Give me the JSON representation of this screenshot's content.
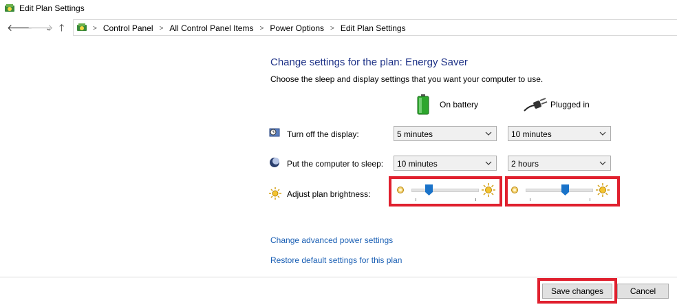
{
  "window": {
    "title": "Edit Plan Settings"
  },
  "nav": {
    "back": "back",
    "forward": "forward",
    "recent": "recent",
    "up": "up"
  },
  "breadcrumb": [
    "Control Panel",
    "All Control Panel Items",
    "Power Options",
    "Edit Plan Settings"
  ],
  "main": {
    "heading": "Change settings for the plan: Energy Saver",
    "subheading": "Choose the sleep and display settings that you want your computer to use.",
    "columns": {
      "battery": "On battery",
      "plugged": "Plugged in"
    },
    "rows": {
      "display": {
        "label": "Turn off the display:",
        "battery": "5 minutes",
        "plugged": "10 minutes"
      },
      "sleep": {
        "label": "Put the computer to sleep:",
        "battery": "10 minutes",
        "plugged": "2 hours"
      },
      "brightness": {
        "label": "Adjust plan brightness:",
        "battery_level": 0.25,
        "plugged_level": 0.58
      }
    },
    "links": {
      "advanced": "Change advanced power settings",
      "restore": "Restore default settings for this plan"
    }
  },
  "footer": {
    "save": "Save changes",
    "cancel": "Cancel"
  },
  "colors": {
    "highlight": "#e0202e",
    "heading": "#1e3287",
    "link": "#1a5fb4",
    "thumb": "#1a73c9"
  }
}
